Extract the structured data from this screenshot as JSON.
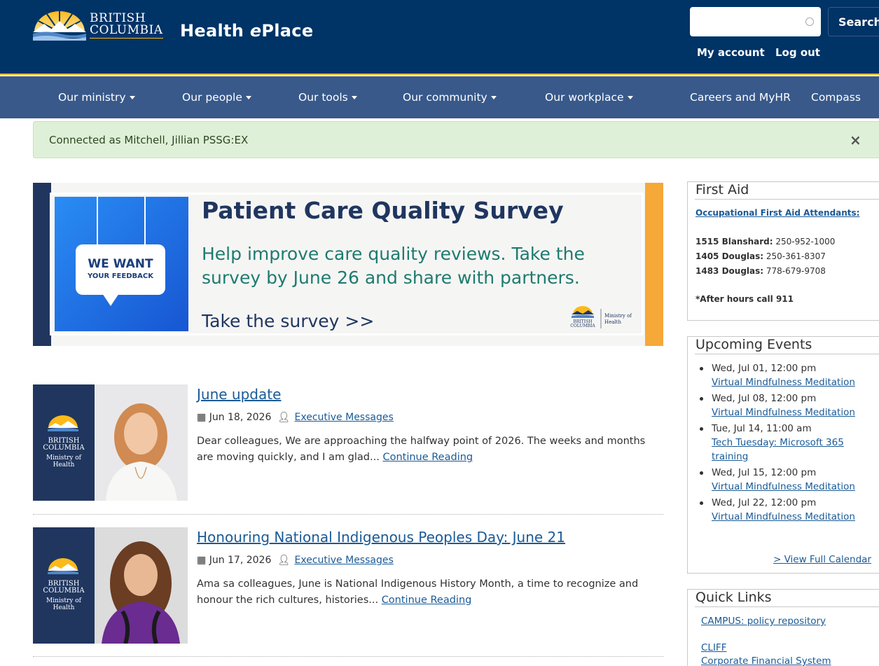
{
  "header": {
    "logo_line1": "BRITISH",
    "logo_line2": "COLUMBIA",
    "site_title_prefix": "Health ",
    "site_title_italic": "e",
    "site_title_suffix": "Place",
    "search_placeholder": "",
    "search_button": "Search",
    "my_account": "My account",
    "log_out": "Log out"
  },
  "nav": {
    "items": [
      {
        "label": "Our ministry",
        "dropdown": true
      },
      {
        "label": "Our people",
        "dropdown": true
      },
      {
        "label": "Our tools",
        "dropdown": true
      },
      {
        "label": "Our community",
        "dropdown": true
      },
      {
        "label": "Our workplace",
        "dropdown": true
      },
      {
        "label": "Careers and MyHR",
        "dropdown": false
      },
      {
        "label": "Compass",
        "dropdown": false
      }
    ]
  },
  "alert": {
    "text": "Connected as Mitchell, Jillian PSSG:EX",
    "close": "×"
  },
  "banner": {
    "bubble_line1": "WE WANT",
    "bubble_line2": "YOUR FEEDBACK",
    "title": "Patient Care Quality Survey",
    "subtitle": "Help improve care quality reviews. Take the survey by June 26 and share with partners.",
    "cta": "Take the survey >>",
    "logo_text1": "BRITISH",
    "logo_text2": "COLUMBIA",
    "ministry_line1": "Ministry of",
    "ministry_line2": "Health"
  },
  "articles": [
    {
      "title": "June update",
      "date": "Jun 18, 2026",
      "category": "Executive Messages",
      "excerpt": "Dear colleagues, We are approaching the halfway point of 2026. The weeks and months are moving quickly, and I am glad...",
      "read_more": "Continue Reading",
      "thumb_line1": "BRITISH",
      "thumb_line2": "COLUMBIA",
      "thumb_line3": "Ministry of",
      "thumb_line4": "Health"
    },
    {
      "title": "Honouring National Indigenous Peoples Day: June 21",
      "date": "Jun 17, 2026",
      "category": "Executive Messages",
      "excerpt": "Ama sa colleagues, June is National Indigenous History Month, a time to recognize and honour the rich cultures, histories...",
      "read_more": "Continue Reading",
      "thumb_line1": "BRITISH",
      "thumb_line2": "COLUMBIA",
      "thumb_line3": "Ministry of",
      "thumb_line4": "Health"
    }
  ],
  "first_aid": {
    "title": "First Aid",
    "link": "Occupational First Aid Attendants:",
    "contacts": [
      {
        "label": "1515 Blanshard:",
        "phone": "250-952-1000"
      },
      {
        "label": "1405 Douglas:",
        "phone": "250-361-8307"
      },
      {
        "label": "1483 Douglas:",
        "phone": "778-679-9708"
      }
    ],
    "after_hours": "*After hours call 911"
  },
  "events": {
    "title": "Upcoming Events",
    "items": [
      {
        "date": "Wed, Jul 01, 12:00 pm",
        "name": "Virtual Mindfulness Meditation"
      },
      {
        "date": "Wed, Jul 08, 12:00 pm",
        "name": "Virtual Mindfulness Meditation"
      },
      {
        "date": "Tue, Jul 14, 11:00 am",
        "name": "Tech Tuesday: Microsoft 365 training"
      },
      {
        "date": "Wed, Jul 15, 12:00 pm",
        "name": "Virtual Mindfulness Meditation"
      },
      {
        "date": "Wed, Jul 22, 12:00 pm",
        "name": "Virtual Mindfulness Meditation"
      }
    ],
    "view_calendar": "> View Full Calendar"
  },
  "quick_links": {
    "title": "Quick Links",
    "items": [
      "CAMPUS: policy repository",
      "CLIFF",
      "Corporate Financial System"
    ]
  },
  "colors": {
    "header_bg": "#003366",
    "nav_bg": "#38598a",
    "accent_gold": "#fcba19",
    "link": "#1a5a96",
    "alert_bg": "#dff0d8"
  }
}
